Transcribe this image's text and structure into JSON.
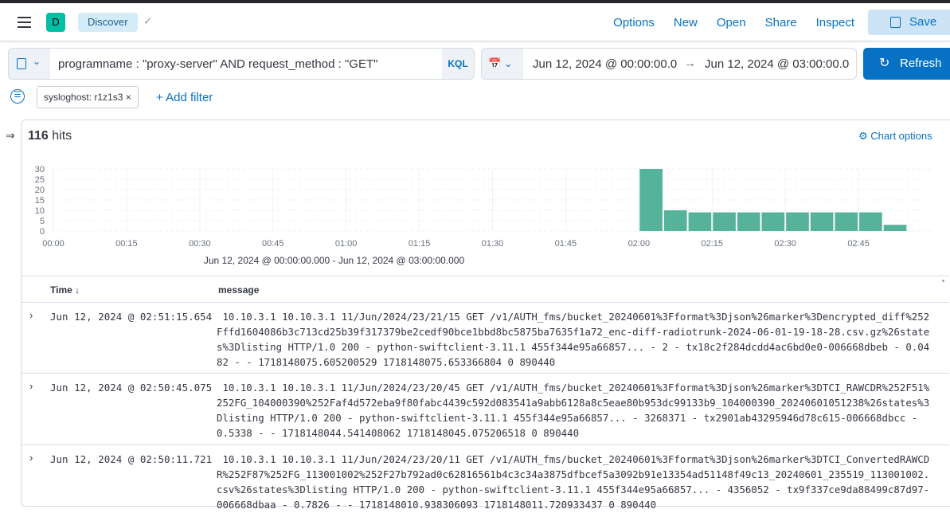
{
  "header": {
    "space_initial": "D",
    "breadcrumb": "Discover",
    "nav": [
      "Options",
      "New",
      "Open",
      "Share",
      "Inspect"
    ],
    "save_label": "Save"
  },
  "query": {
    "text": "programname : \"proxy-server\" AND request_method : \"GET\"",
    "language": "KQL"
  },
  "time": {
    "start": "Jun 12, 2024 @ 00:00:00.0",
    "end": "Jun 12, 2024 @ 03:00:00.0",
    "refresh_label": "Refresh"
  },
  "filters": {
    "pill": "sysloghost: r1z1s3",
    "add_label": "+ Add filter"
  },
  "results": {
    "hits_count": "116",
    "hits_label": "hits",
    "chart_options": "Chart options",
    "range_label": "Jun 12, 2024 @ 00:00:00.000 - Jun 12, 2024 @ 03:00:00.000"
  },
  "chart_data": {
    "type": "bar",
    "xlabel": "Jun 12, 2024 @ 00:00:00.000 - Jun 12, 2024 @ 03:00:00.000",
    "x_ticks": [
      "00:00",
      "00:15",
      "00:30",
      "00:45",
      "01:00",
      "01:15",
      "01:30",
      "01:45",
      "02:00",
      "02:15",
      "02:30",
      "02:45"
    ],
    "y_ticks": [
      0,
      5,
      10,
      15,
      20,
      25,
      30
    ],
    "ylim": [
      0,
      30
    ],
    "interval_minutes": 5,
    "range_minutes": 180,
    "bars": [
      {
        "start": "02:00",
        "minute": 120,
        "value": 30
      },
      {
        "start": "02:05",
        "minute": 125,
        "value": 10
      },
      {
        "start": "02:10",
        "minute": 130,
        "value": 9
      },
      {
        "start": "02:15",
        "minute": 135,
        "value": 9
      },
      {
        "start": "02:20",
        "minute": 140,
        "value": 9
      },
      {
        "start": "02:25",
        "minute": 145,
        "value": 9
      },
      {
        "start": "02:30",
        "minute": 150,
        "value": 9
      },
      {
        "start": "02:35",
        "minute": 155,
        "value": 9
      },
      {
        "start": "02:40",
        "minute": 160,
        "value": 9
      },
      {
        "start": "02:45",
        "minute": 165,
        "value": 9
      },
      {
        "start": "02:50",
        "minute": 170,
        "value": 3
      }
    ],
    "color": "#54b399"
  },
  "table": {
    "columns": [
      "Time ↓",
      "message"
    ],
    "rows": [
      {
        "time": "Jun 12, 2024 @ 02:51:15.654",
        "message": " 10.10.3.1 10.10.3.1 11/Jun/2024/23/21/15 GET /v1/AUTH_fms/bucket_20240601%3Fformat%3Djson%26marker%3Dencrypted_diff%252Fffd1604086b3c713cd25b39f317379be2cedf90bce1bbd8bc5875ba7635f1a72_enc-diff-radiotrunk-2024-06-01-19-18-28.csv.gz%26states%3Dlisting HTTP/1.0 200 - python-swiftclient-3.11.1 455f344e95a66857... - 2 - tx18c2f284dcdd4ac6bd0e0-006668dbeb - 0.0482 - - 1718148075.605200529 1718148075.653366804 0 890440"
      },
      {
        "time": "Jun 12, 2024 @ 02:50:45.075",
        "message": " 10.10.3.1 10.10.3.1 11/Jun/2024/23/20/45 GET /v1/AUTH_fms/bucket_20240601%3Fformat%3Djson%26marker%3DTCI_RAWCDR%252F51%252FG_104000390%252Faf4d572eba9f80fabc4439c592d083541a9abb6128a8c5eae80b953dc99133b9_104000390_20240601051238%26states%3Dlisting HTTP/1.0 200 - python-swiftclient-3.11.1 455f344e95a66857... - 3268371 - tx2901ab43295946d78c615-006668dbcc - 0.5338 - - 1718148044.541408062 1718148045.075206518 0 890440"
      },
      {
        "time": "Jun 12, 2024 @ 02:50:11.721",
        "message": " 10.10.3.1 10.10.3.1 11/Jun/2024/23/20/11 GET /v1/AUTH_fms/bucket_20240601%3Fformat%3Djson%26marker%3DTCI_ConvertedRAWCDR%252F87%252FG_113001002%252F27b792ad0c62816561b4c3c34a3875dfbcef5a3092b91e13354ad51148f49c13_20240601_235519_113001002.csv%26states%3Dlisting HTTP/1.0 200 - python-swiftclient-3.11.1 455f344e95a66857... - 4356052 - tx9f337ce9da88499c87d97-006668dbaa - 0.7826 - - 1718148010.938306093 1718148011.720933437 0 890440"
      }
    ]
  }
}
